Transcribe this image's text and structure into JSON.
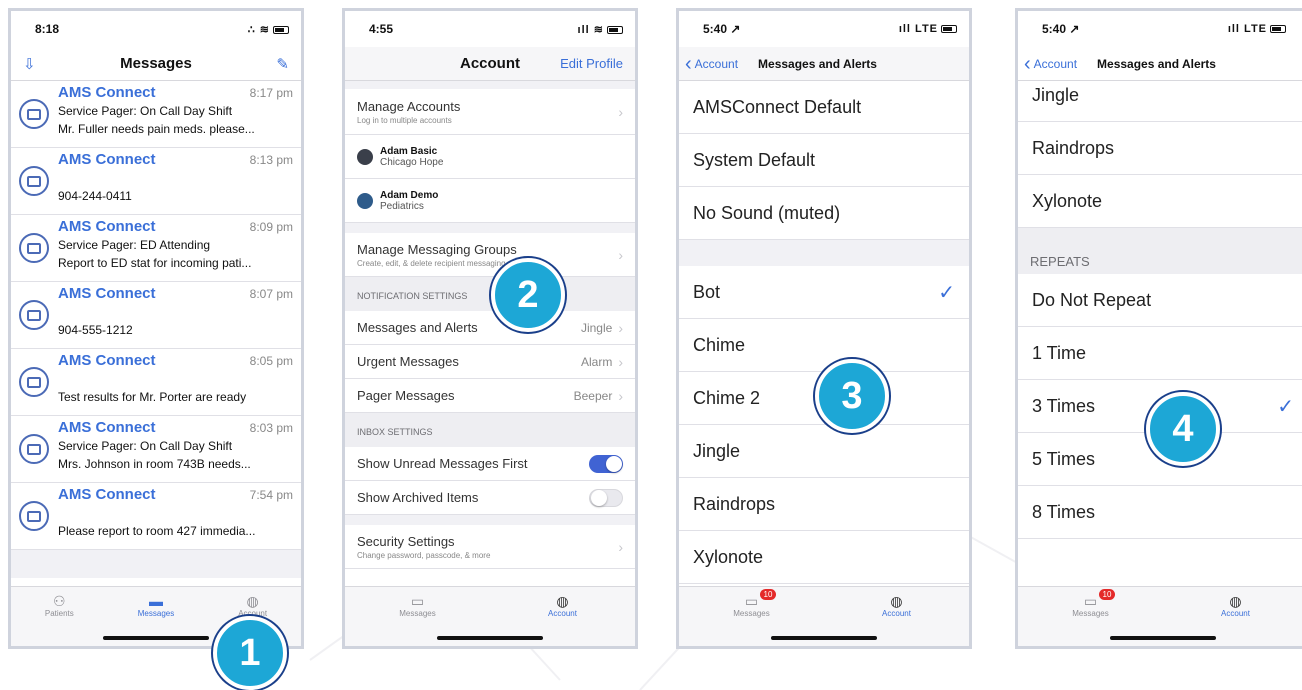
{
  "phone1": {
    "status": {
      "time": "8:18",
      "icons": "∴ ≋"
    },
    "nav": {
      "title": "Messages"
    },
    "messages": [
      {
        "from": "AMS Connect",
        "time": "8:17 pm",
        "line1": "Service Pager: On Call Day Shift",
        "line2": "Mr. Fuller needs pain meds. please..."
      },
      {
        "from": "AMS Connect",
        "time": "8:13 pm",
        "line1": "",
        "line2": "904-244-0411"
      },
      {
        "from": "AMS Connect",
        "time": "8:09 pm",
        "line1": "Service Pager: ED Attending",
        "line2": "Report to ED stat for incoming pati..."
      },
      {
        "from": "AMS Connect",
        "time": "8:07 pm",
        "line1": "",
        "line2": "904-555-1212"
      },
      {
        "from": "AMS Connect",
        "time": "8:05 pm",
        "line1": "",
        "line2": "Test results for Mr. Porter are ready"
      },
      {
        "from": "AMS Connect",
        "time": "8:03 pm",
        "line1": "Service Pager: On Call Day Shift",
        "line2": "Mrs. Johnson in room 743B needs..."
      },
      {
        "from": "AMS Connect",
        "time": "7:54 pm",
        "line1": "",
        "line2": "Please report to room 427 immedia..."
      }
    ],
    "tabs": [
      "Patients",
      "Messages",
      "Account"
    ]
  },
  "phone2": {
    "status": {
      "time": "4:55",
      "icons": "ıll ≋"
    },
    "nav": {
      "title": "Account",
      "edit": "Edit Profile"
    },
    "manage_accounts": {
      "title": "Manage Accounts",
      "sub": "Log in to multiple accounts"
    },
    "accounts": [
      {
        "name": "Adam Basic",
        "org": "Chicago Hope"
      },
      {
        "name": "Adam Demo",
        "org": "Pediatrics"
      }
    ],
    "manage_groups": {
      "title": "Manage Messaging Groups",
      "sub": "Create, edit, & delete recipient messaging groups"
    },
    "notification_header": "NOTIFICATION SETTINGS",
    "notifications": [
      {
        "label": "Messages and Alerts",
        "value": "Jingle"
      },
      {
        "label": "Urgent Messages",
        "value": "Alarm"
      },
      {
        "label": "Pager Messages",
        "value": "Beeper"
      }
    ],
    "inbox_header": "INBOX SETTINGS",
    "inbox": [
      {
        "label": "Show Unread Messages First",
        "on": true
      },
      {
        "label": "Show Archived Items",
        "on": false
      }
    ],
    "security": {
      "title": "Security Settings",
      "sub": "Change password, passcode, & more"
    },
    "tabs": [
      "Messages",
      "Account"
    ]
  },
  "phone3": {
    "status": {
      "time": "5:40 ↗",
      "icons": "ıll LTE"
    },
    "nav": {
      "back": "Account",
      "title": "Messages and Alerts"
    },
    "group1": [
      "AMSConnect Default",
      "System Default",
      "No Sound (muted)"
    ],
    "group2": [
      "Bot",
      "Chime",
      "Chime 2",
      "Jingle",
      "Raindrops",
      "Xylonote"
    ],
    "selected": "Bot",
    "tabs": [
      "Messages",
      "Account"
    ],
    "badge": "10"
  },
  "phone4": {
    "status": {
      "time": "5:40 ↗",
      "icons": "ıll LTE"
    },
    "nav": {
      "back": "Account",
      "title": "Messages and Alerts"
    },
    "group1": [
      "Jingle",
      "Raindrops",
      "Xylonote"
    ],
    "repeats_header": "REPEATS",
    "repeats": [
      "Do Not Repeat",
      "1 Time",
      "3 Times",
      "5 Times",
      "8 Times"
    ],
    "selected": "3 Times",
    "tabs": [
      "Messages",
      "Account"
    ],
    "badge": "10"
  },
  "callouts": [
    "1",
    "2",
    "3",
    "4"
  ],
  "colors": {
    "accent": "#3a6fd8",
    "callout": "#1da7d6",
    "toggle_on": "#4063d3",
    "badge": "#e42a2a"
  }
}
